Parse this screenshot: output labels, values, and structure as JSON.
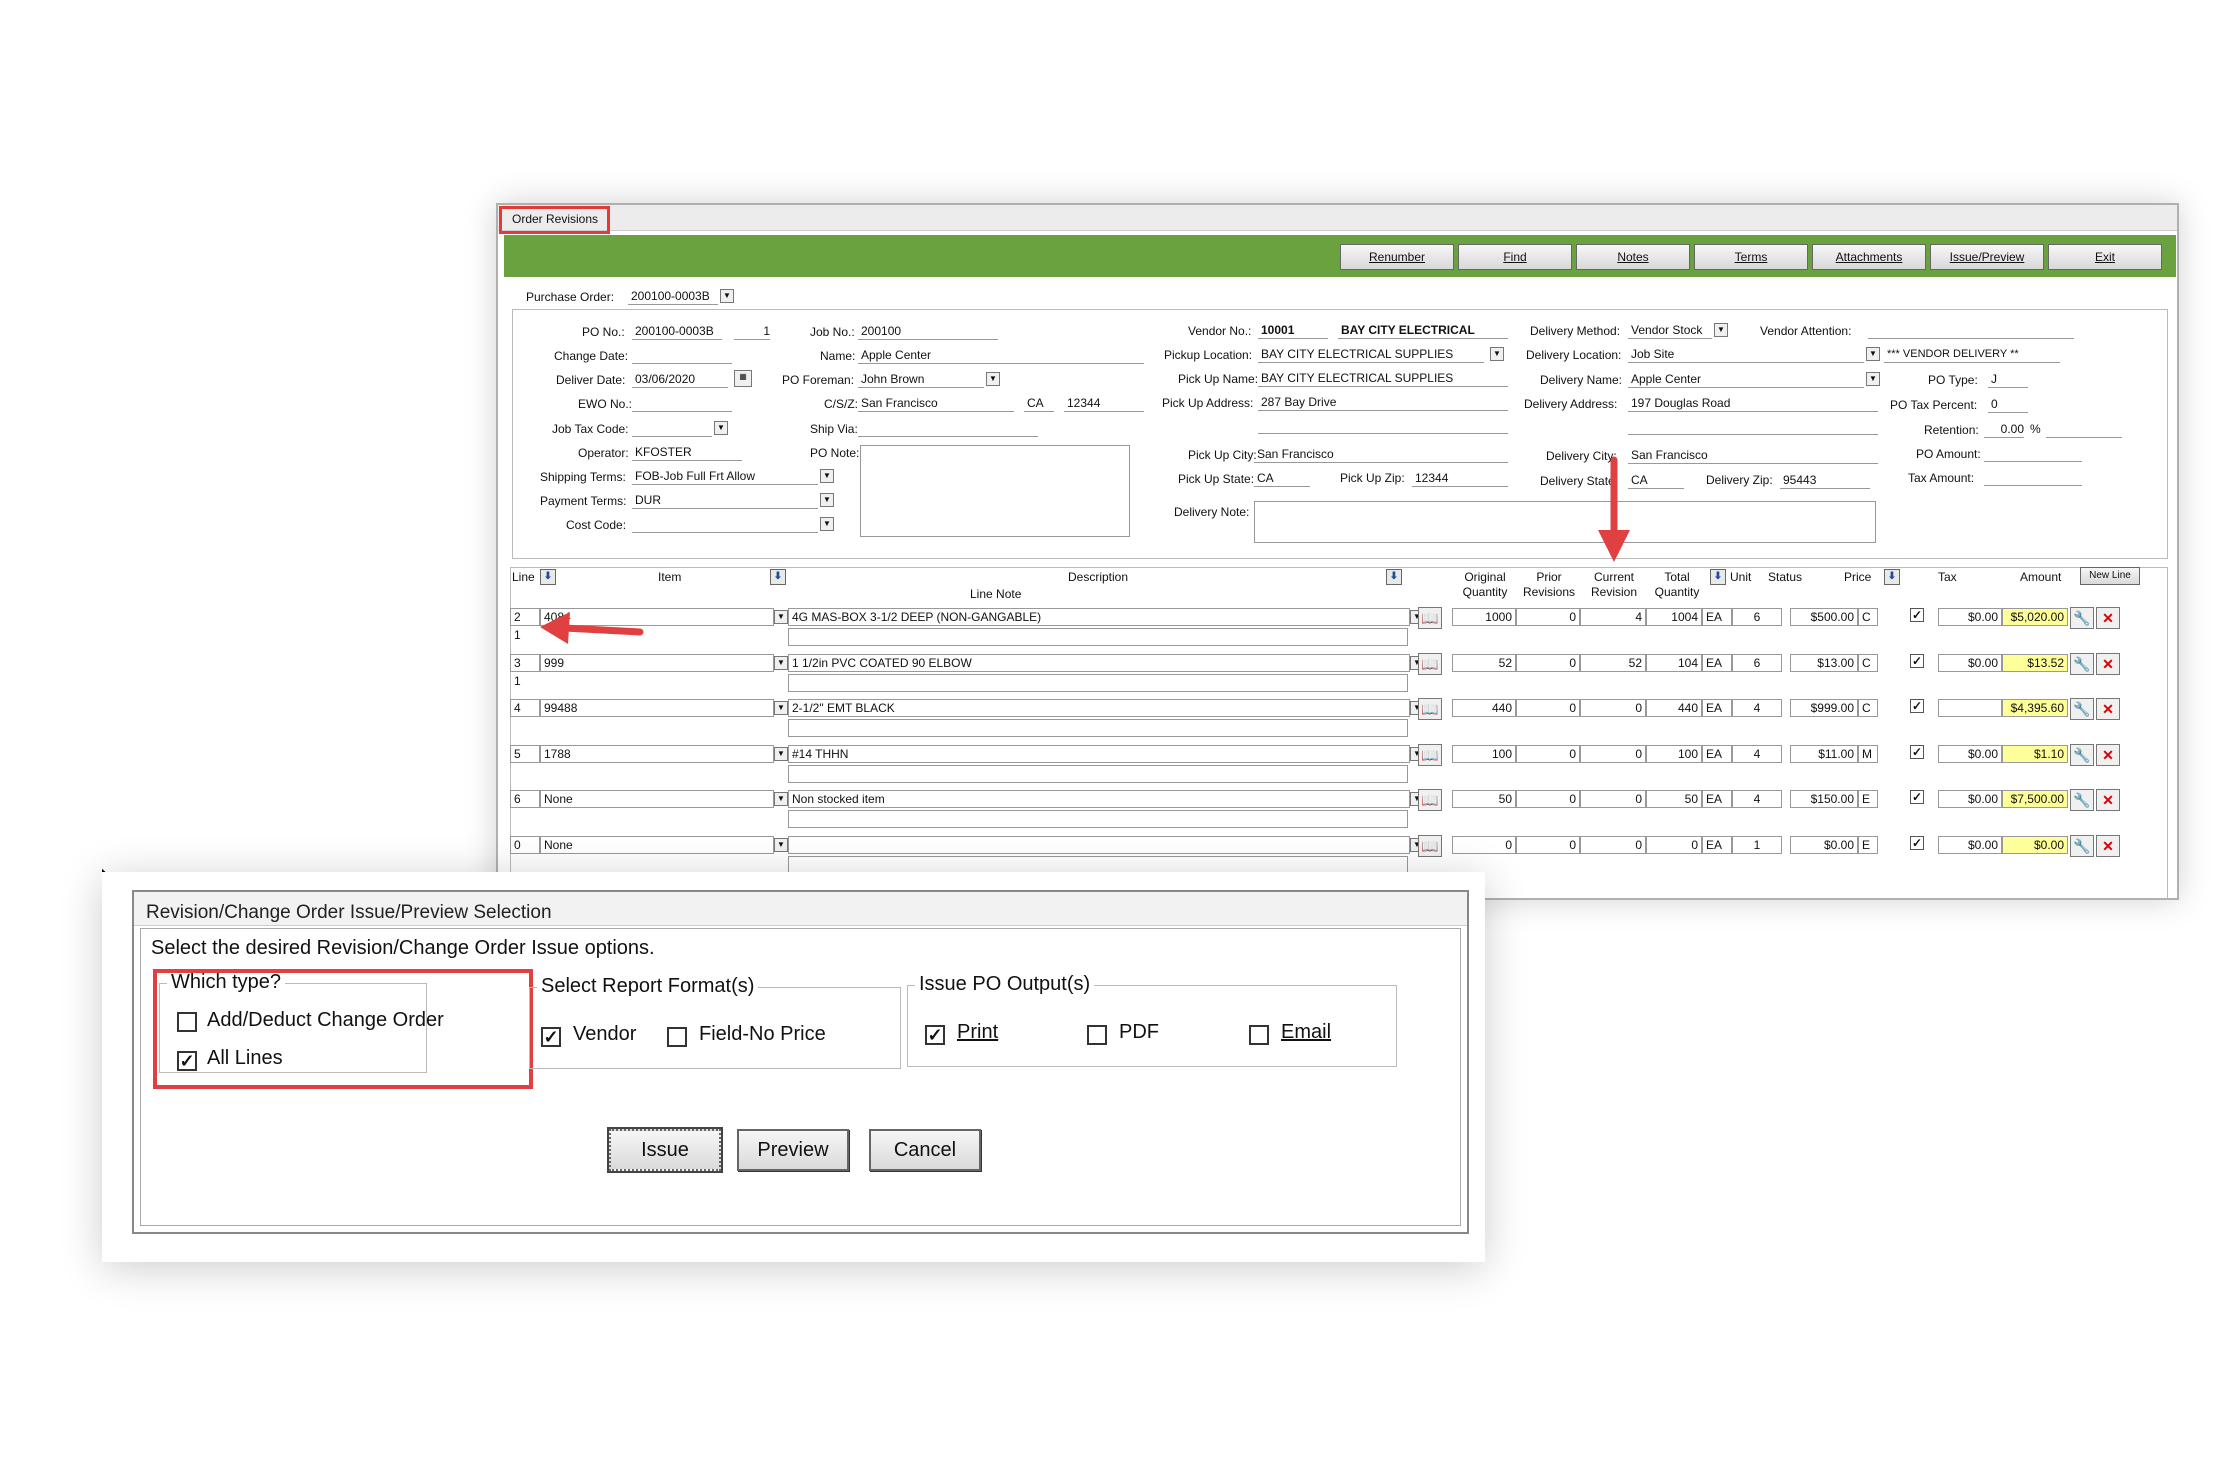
{
  "main_window": {
    "title": "Order Revisions",
    "toolbar": [
      "Renumber",
      "Find",
      "Notes",
      "Terms",
      "Attachments",
      "Issue/Preview",
      "Exit"
    ],
    "purchase_order": {
      "label": "Purchase Order:",
      "value": "200100-0003B"
    },
    "f": {
      "po_no_l": "PO No.:",
      "po_no": "200100-0003B",
      "po_seq": "1",
      "change_date_l": "Change Date:",
      "deliver_date_l": "Deliver Date:",
      "deliver_date": "03/06/2020",
      "ewo_l": "EWO No.:",
      "jtc_l": "Job Tax Code:",
      "operator_l": "Operator:",
      "operator": "KFOSTER",
      "ship_terms_l": "Shipping Terms:",
      "ship_terms": "FOB-Job Full Frt Allow",
      "pay_terms_l": "Payment Terms:",
      "pay_terms": "DUR",
      "cost_code_l": "Cost Code:",
      "job_no_l": "Job No.:",
      "job_no": "200100",
      "name_l": "Name:",
      "name": "Apple Center",
      "foreman_l": "PO Foreman:",
      "foreman": "John Brown",
      "csz_l": "C/S/Z:",
      "city": "San Francisco",
      "state": "CA",
      "zip": "12344",
      "ship_via_l": "Ship Via:",
      "po_note_l": "PO Note:",
      "vendor_no_l": "Vendor No.:",
      "vendor_no": "10001",
      "vendor_name": "BAY CITY ELECTRICAL",
      "pickup_loc_l": "Pickup Location:",
      "pickup_loc": "BAY CITY ELECTRICAL SUPPLIES",
      "pickup_name_l": "Pick Up Name:",
      "pickup_name": "BAY CITY ELECTRICAL SUPPLIES",
      "pickup_addr_l": "Pick Up Address:",
      "pickup_addr": "287 Bay Drive",
      "pickup_city_l": "Pick Up City:",
      "pickup_city": "San Francisco",
      "pickup_state_l": "Pick Up State:",
      "pickup_state": "CA",
      "pickup_zip_l": "Pick Up Zip:",
      "pickup_zip": "12344",
      "delivery_note_l": "Delivery Note:",
      "del_method_l": "Delivery Method:",
      "del_method": "Vendor Stock",
      "vendor_att_l": "Vendor Attention:",
      "del_loc_l": "Delivery Location:",
      "del_loc": "Job Site",
      "vendor_delivery": "*** VENDOR DELIVERY **",
      "del_name_l": "Delivery Name:",
      "del_name": "Apple Center",
      "po_type_l": "PO Type:",
      "po_type": "J",
      "del_addr_l": "Delivery Address:",
      "del_addr": "197 Douglas Road",
      "po_tax_l": "PO Tax Percent:",
      "po_tax": "0",
      "retention_l": "Retention:",
      "retention": "0.00",
      "pct": "%",
      "del_city_l": "Delivery City:",
      "del_city": "San Francisco",
      "po_amount_l": "PO Amount:",
      "del_state_l": "Delivery State:",
      "del_state": "CA",
      "del_zip_l": "Delivery Zip:",
      "del_zip": "95443",
      "tax_amount_l": "Tax Amount:"
    },
    "grid": {
      "headers": {
        "line": "Line",
        "item": "Item",
        "description": "Description",
        "line_note": "Line Note",
        "orig_qty": "Original Quantity",
        "prior_rev": "Prior Revisions",
        "cur_rev": "Current Revision",
        "total_qty": "Total Quantity",
        "unit": "Unit",
        "status": "Status",
        "price": "Price",
        "tax": "Tax",
        "amount": "Amount",
        "new_line": "New Line"
      },
      "rows": [
        {
          "line": "2",
          "sub": "1",
          "item": "4084",
          "desc": "4G MAS-BOX 3-1/2 DEEP (NON-GANGABLE)",
          "orig": "1000",
          "prior": "0",
          "cur": "4",
          "total": "1004",
          "unit": "EA",
          "status": "6",
          "price": "$500.00",
          "pc": "C",
          "tax": "$0.00",
          "amount": "$5,020.00"
        },
        {
          "line": "3",
          "sub": "1",
          "item": "999",
          "desc": "1 1/2in PVC COATED 90 ELBOW",
          "orig": "52",
          "prior": "0",
          "cur": "52",
          "total": "104",
          "unit": "EA",
          "status": "6",
          "price": "$13.00",
          "pc": "C",
          "tax": "$0.00",
          "amount": "$13.52"
        },
        {
          "line": "4",
          "sub": "",
          "item": "99488",
          "desc": "2-1/2\" EMT BLACK",
          "orig": "440",
          "prior": "0",
          "cur": "0",
          "total": "440",
          "unit": "EA",
          "status": "4",
          "price": "$999.00",
          "pc": "C",
          "tax": "",
          "amount": "$4,395.60"
        },
        {
          "line": "5",
          "sub": "",
          "item": "1788",
          "desc": "#14 THHN",
          "orig": "100",
          "prior": "0",
          "cur": "0",
          "total": "100",
          "unit": "EA",
          "status": "4",
          "price": "$11.00",
          "pc": "M",
          "tax": "$0.00",
          "amount": "$1.10"
        },
        {
          "line": "6",
          "sub": "",
          "item": "None",
          "desc": "Non stocked item",
          "orig": "50",
          "prior": "0",
          "cur": "0",
          "total": "50",
          "unit": "EA",
          "status": "4",
          "price": "$150.00",
          "pc": "E",
          "tax": "$0.00",
          "amount": "$7,500.00"
        },
        {
          "line": "0",
          "sub": "",
          "item": "None",
          "desc": "",
          "orig": "0",
          "prior": "0",
          "cur": "0",
          "total": "0",
          "unit": "EA",
          "status": "1",
          "price": "$0.00",
          "pc": "E",
          "tax": "$0.00",
          "amount": "$0.00"
        }
      ]
    }
  },
  "dialog": {
    "title": "Revision/Change Order Issue/Preview Selection",
    "instruction": "Select the desired Revision/Change Order Issue options.",
    "which_type": {
      "legend": "Which type?",
      "options": [
        {
          "label": "Add/Deduct Change Order",
          "checked": false
        },
        {
          "label": "All Lines",
          "checked": true
        }
      ]
    },
    "report_format": {
      "legend": "Select Report Format(s)",
      "options": [
        {
          "label": "Vendor",
          "checked": true
        },
        {
          "label": "Field-No Price",
          "checked": false
        }
      ]
    },
    "output": {
      "legend": "Issue PO Output(s)",
      "options": [
        {
          "label": "Print",
          "checked": true
        },
        {
          "label": "PDF",
          "checked": false
        },
        {
          "label": "Email",
          "checked": false
        }
      ]
    },
    "buttons": [
      "Issue",
      "Preview",
      "Cancel"
    ]
  },
  "colors": {
    "toolbar": "#6aa240",
    "highlight": "#e04040",
    "amount_bg": "#ffff99"
  }
}
